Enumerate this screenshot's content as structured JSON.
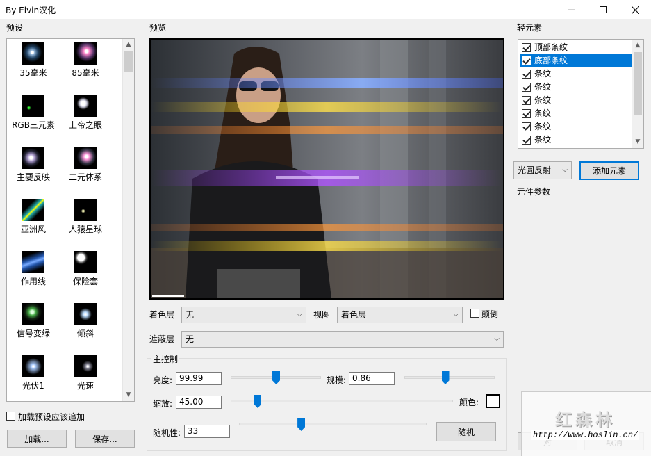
{
  "window": {
    "title": "By Elvin汉化"
  },
  "sections": {
    "presets": "预设",
    "preview": "预览",
    "elements": "轻元素",
    "params": "元件参数",
    "main_control": "主控制"
  },
  "presets": [
    {
      "label": "35毫米"
    },
    {
      "label": "85毫米"
    },
    {
      "label": "RGB三元素"
    },
    {
      "label": "上帝之眼"
    },
    {
      "label": "主要反映"
    },
    {
      "label": "二元体系"
    },
    {
      "label": "亚洲风"
    },
    {
      "label": "人猿星球"
    },
    {
      "label": "作用线"
    },
    {
      "label": "保险套"
    },
    {
      "label": "信号变绿"
    },
    {
      "label": "倾斜"
    },
    {
      "label": "光伏1"
    },
    {
      "label": "光速"
    }
  ],
  "preset_append_label": "加载预设应该追加",
  "buttons": {
    "load": "加载...",
    "save": "保存...",
    "add_element": "添加元素",
    "random": "随机",
    "ok": "对",
    "cancel": "取消"
  },
  "layers": {
    "color_label": "着色层",
    "color_value": "无",
    "view_label": "视图",
    "view_value": "着色层",
    "invert_label": "颠倒",
    "mask_label": "遮蔽层",
    "mask_value": "无"
  },
  "controls": {
    "brightness_label": "亮度:",
    "brightness_value": "99.99",
    "scale_label": "规模:",
    "scale_value": "0.86",
    "zoom_label": "缩放:",
    "zoom_value": "45.00",
    "color_label": "颜色:",
    "random_label": "随机性:",
    "random_value": "33"
  },
  "sliders": {
    "brightness": 0.5,
    "scale": 0.45,
    "zoom": 0.12,
    "random": 0.33
  },
  "elements": [
    {
      "label": "顶部条纹",
      "checked": true,
      "selected": false
    },
    {
      "label": "底部条纹",
      "checked": true,
      "selected": true
    },
    {
      "label": "条纹",
      "checked": true,
      "selected": false
    },
    {
      "label": "条纹",
      "checked": true,
      "selected": false
    },
    {
      "label": "条纹",
      "checked": true,
      "selected": false
    },
    {
      "label": "条纹",
      "checked": true,
      "selected": false
    },
    {
      "label": "条纹",
      "checked": true,
      "selected": false
    },
    {
      "label": "条纹",
      "checked": true,
      "selected": false
    }
  ],
  "element_type": "光圆反射",
  "watermark": {
    "brand": "红森林",
    "url": "http://www.hoslin.cn/"
  },
  "colors": {
    "accent": "#0078d7",
    "swatch": "#ffffff"
  }
}
